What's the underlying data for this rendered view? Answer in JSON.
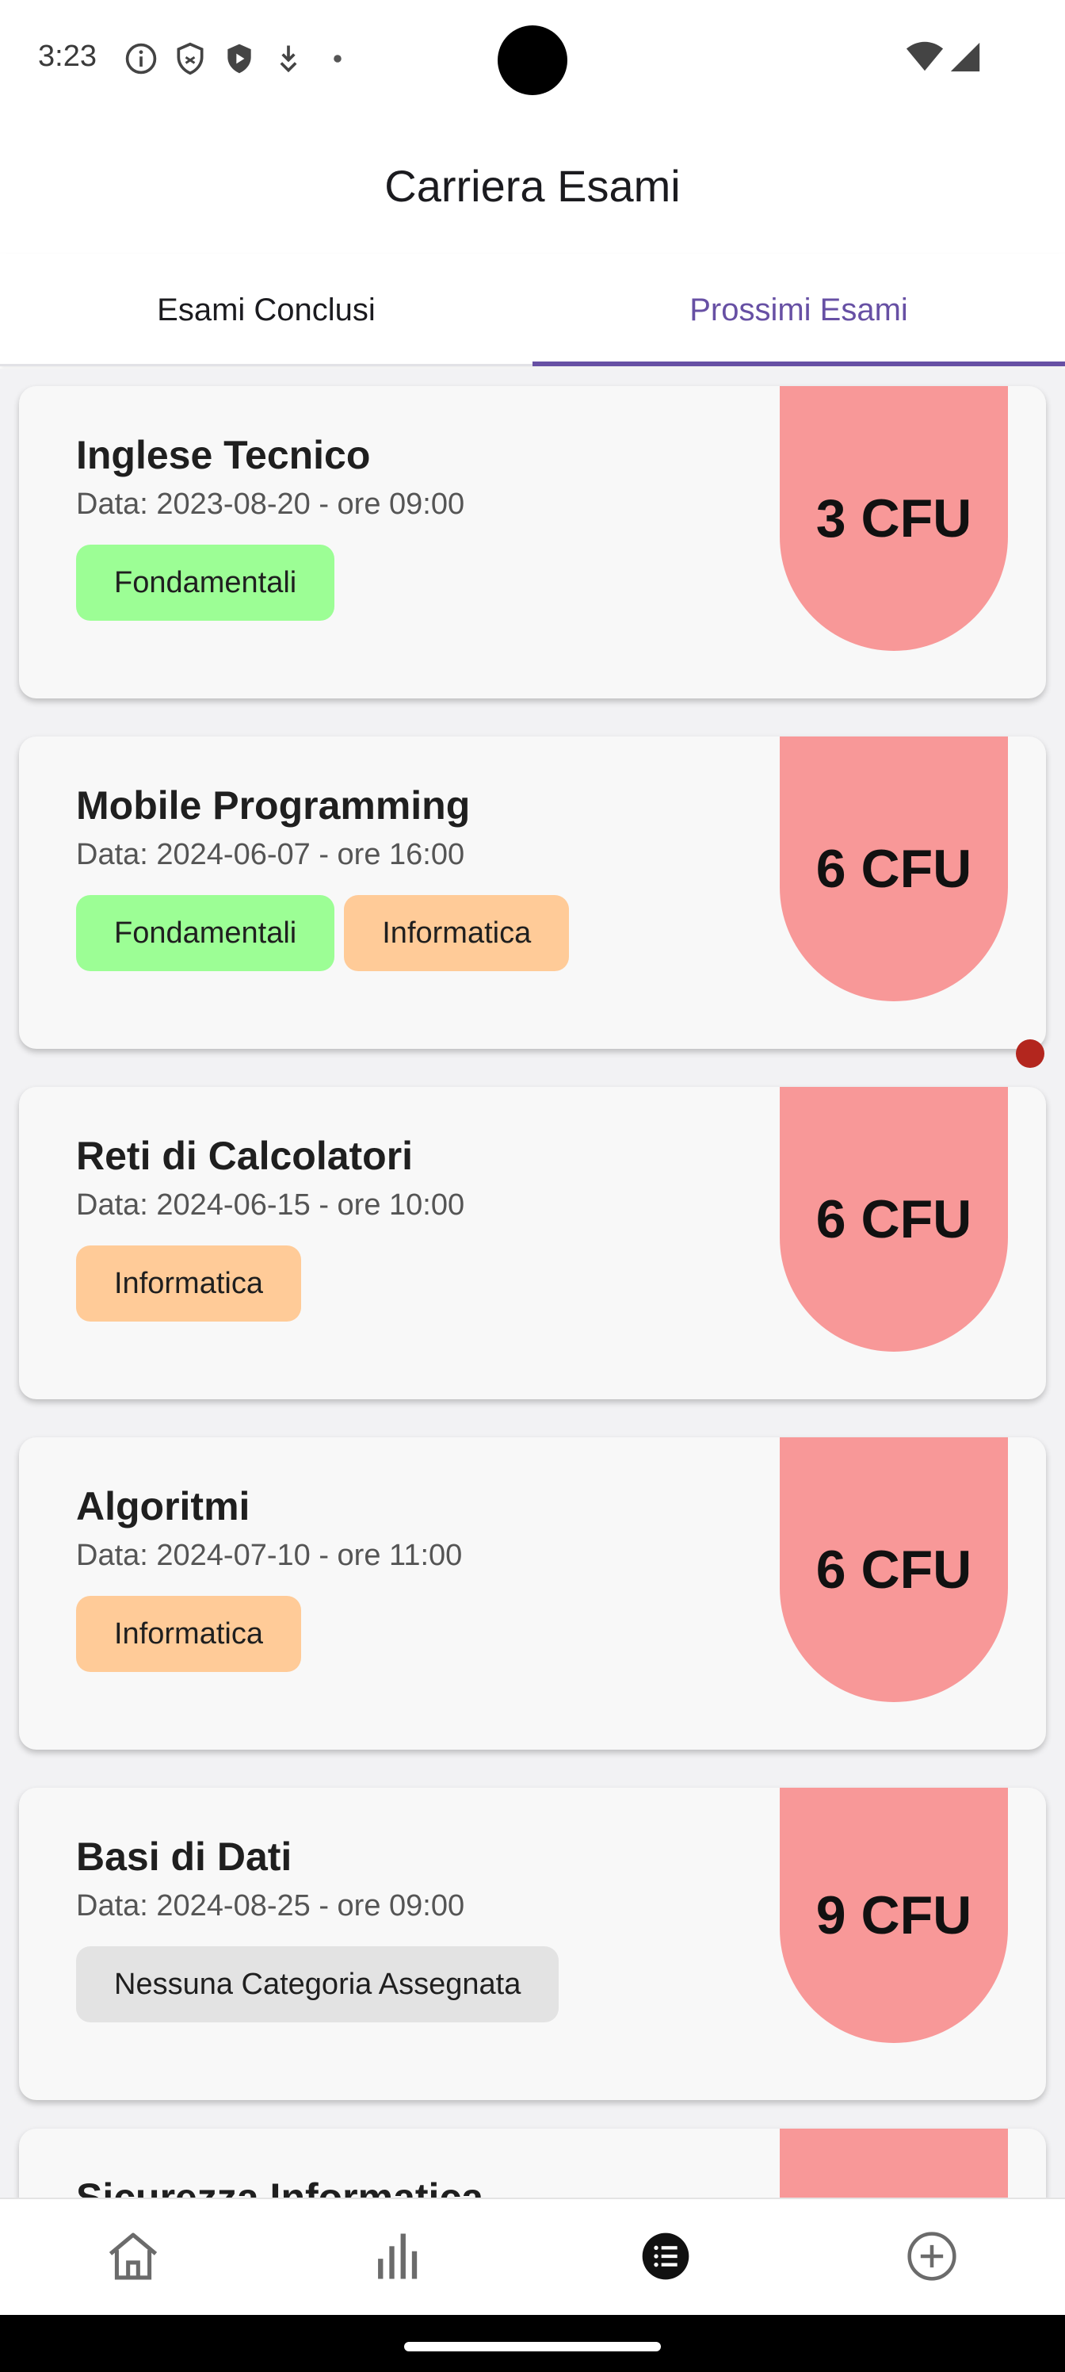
{
  "status_bar": {
    "time": "3:23",
    "icons": [
      "info-icon",
      "shield-icon",
      "shield-play-icon",
      "download-icon",
      "dot-icon"
    ],
    "right_icons": [
      "wifi-icon",
      "cellular-icon"
    ]
  },
  "app_bar": {
    "title": "Carriera Esami"
  },
  "tabs": [
    {
      "label": "Esami Conclusi",
      "selected": false
    },
    {
      "label": "Prossimi Esami",
      "selected": true
    }
  ],
  "colors": {
    "accent": "#6750a4",
    "cfu_badge": "#f89898",
    "chip_fondamentali": "#9cfe95",
    "chip_informatica": "#ffcb98",
    "chip_none": "#e3e3e3",
    "notification_dot": "#b3261e"
  },
  "exams": [
    {
      "title": "Inglese Tecnico",
      "date": "Data: 2023-08-20 - ore 09:00",
      "cfu": "3 CFU",
      "chips": [
        "Fondamentali"
      ]
    },
    {
      "title": "Mobile Programming",
      "date": "Data: 2024-06-07 - ore 16:00",
      "cfu": "6 CFU",
      "chips": [
        "Fondamentali",
        "Informatica"
      ]
    },
    {
      "title": "Reti di Calcolatori",
      "date": "Data: 2024-06-15 - ore 10:00",
      "cfu": "6 CFU",
      "chips": [
        "Informatica"
      ]
    },
    {
      "title": "Algoritmi",
      "date": "Data: 2024-07-10 - ore 11:00",
      "cfu": "6 CFU",
      "chips": [
        "Informatica"
      ]
    },
    {
      "title": "Basi di Dati",
      "date": "Data: 2024-08-25 - ore 09:00",
      "cfu": "9 CFU",
      "chips": [
        "Nessuna Categoria Assegnata"
      ]
    },
    {
      "title": "Sicurezza Informatica"
    }
  ],
  "bottom_nav": [
    {
      "icon": "home-icon",
      "selected": false
    },
    {
      "icon": "bar-chart-icon",
      "selected": false
    },
    {
      "icon": "list-icon",
      "selected": true
    },
    {
      "icon": "add-circle-icon",
      "selected": false
    }
  ]
}
